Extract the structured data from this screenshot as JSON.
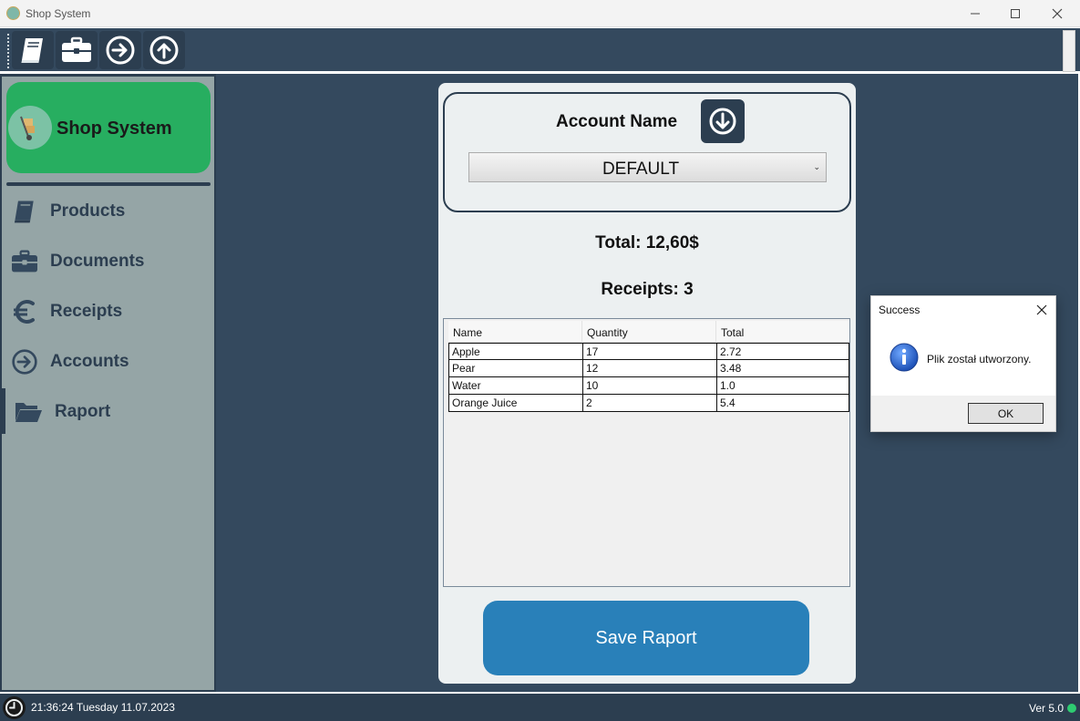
{
  "window": {
    "title": "Shop System",
    "min_icon": "minimize-icon",
    "max_icon": "maximize-icon",
    "close_icon": "close-icon"
  },
  "toolbar": {
    "buttons": [
      {
        "icon": "book-icon"
      },
      {
        "icon": "briefcase-icon"
      },
      {
        "icon": "arrow-right-circle-icon"
      },
      {
        "icon": "arrow-up-circle-icon"
      }
    ]
  },
  "sidebar": {
    "brand": "Shop System",
    "items": [
      {
        "label": "Products",
        "icon": "book-icon"
      },
      {
        "label": "Documents",
        "icon": "briefcase-icon"
      },
      {
        "label": "Receipts",
        "icon": "euro-icon"
      },
      {
        "label": "Accounts",
        "icon": "arrow-right-circle-icon"
      },
      {
        "label": "Raport",
        "icon": "folder-open-icon",
        "active": true
      }
    ]
  },
  "report": {
    "account_label": "Account Name",
    "account_value": "DEFAULT",
    "total": "Total: 12,60$",
    "receipts": "Receipts: 3",
    "columns": [
      "Name",
      "Quantity",
      "Total"
    ],
    "rows": [
      [
        "Apple",
        "17",
        "2.72"
      ],
      [
        "Pear",
        "12",
        "3.48"
      ],
      [
        "Water",
        "10",
        "1.0"
      ],
      [
        "Orange Juice",
        "2",
        "5.4"
      ]
    ],
    "save_label": "Save Raport"
  },
  "dialog": {
    "title": "Success",
    "message": "Plik został utworzony.",
    "ok_label": "OK",
    "icon": "info-icon"
  },
  "status": {
    "datetime": "21:36:24 Tuesday 11.07.2023",
    "version": "Ver 5.0"
  },
  "colors": {
    "primary_dark": "#34495e",
    "sidebar_bg": "#95a5a6",
    "brand_green": "#27ae60",
    "save_blue": "#2980b9",
    "status_dot": "#2ecc71"
  }
}
